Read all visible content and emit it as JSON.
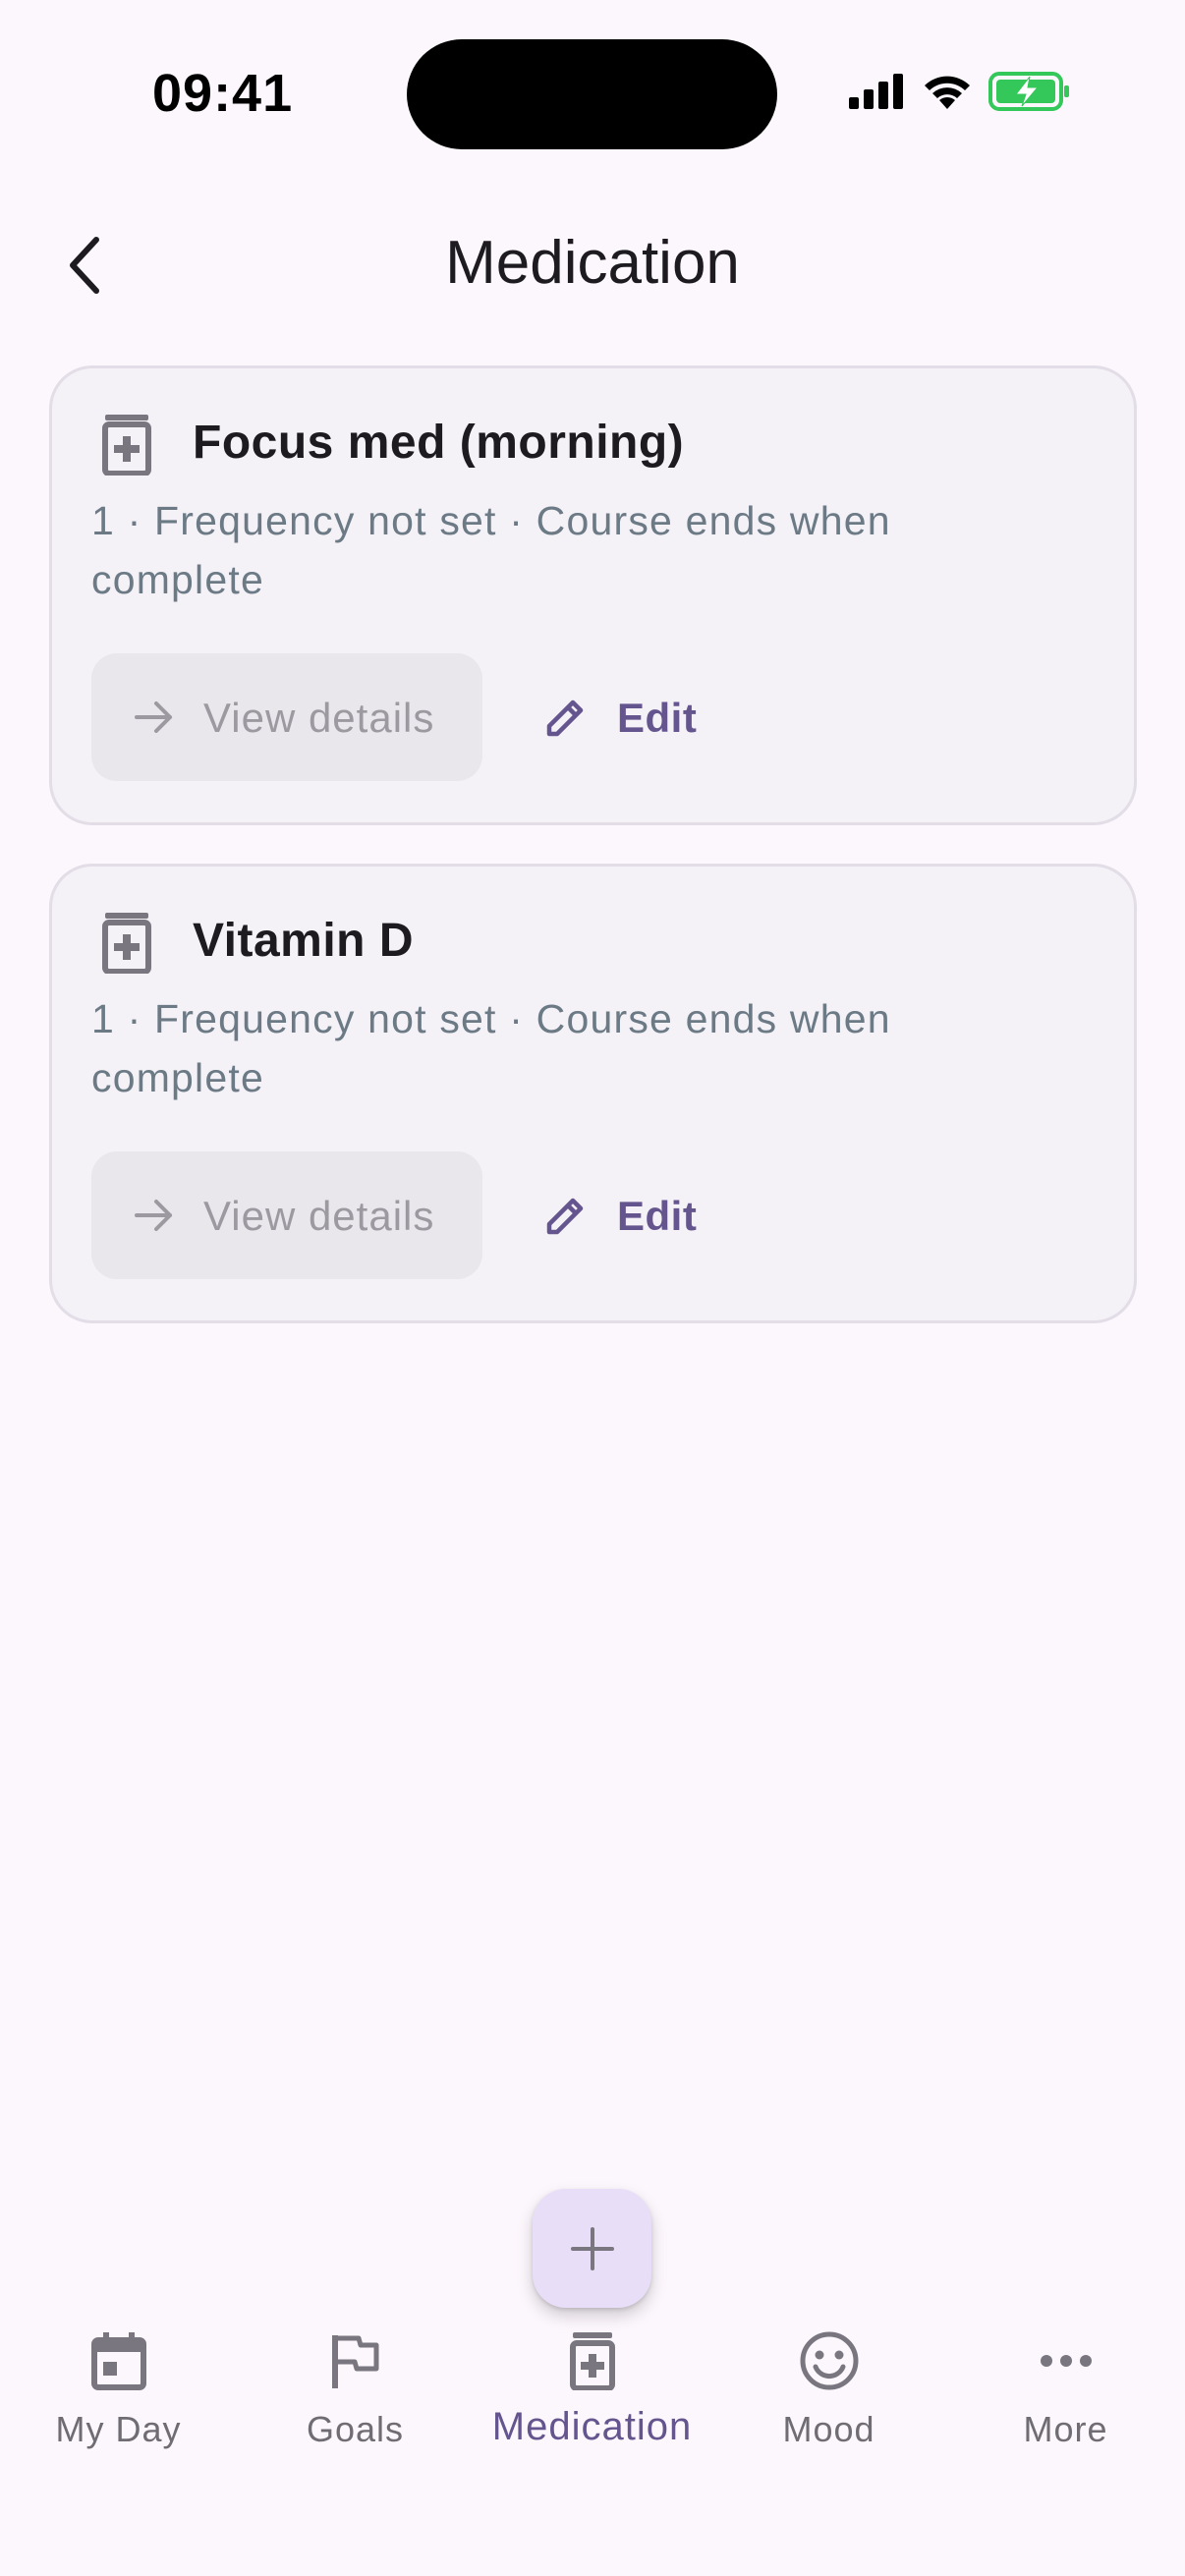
{
  "status_bar": {
    "time": "09:41"
  },
  "header": {
    "title": "Medication"
  },
  "medications": [
    {
      "name": "Focus med (morning)",
      "meta": "1 · Frequency not set · Course ends when complete",
      "view_label": "View details",
      "edit_label": "Edit"
    },
    {
      "name": "Vitamin D",
      "meta": "1 · Frequency not set · Course ends when complete",
      "view_label": "View details",
      "edit_label": "Edit"
    }
  ],
  "nav": {
    "items": [
      {
        "label": "My Day",
        "icon": "calendar-icon"
      },
      {
        "label": "Goals",
        "icon": "flag-icon"
      },
      {
        "label": "Medication",
        "icon": "medication-icon",
        "active": true
      },
      {
        "label": "Mood",
        "icon": "smiley-icon"
      },
      {
        "label": "More",
        "icon": "more-horizontal-icon"
      }
    ]
  },
  "colors": {
    "background": "#fcf7fd",
    "accent": "#65558f",
    "card": "#f4f1f7",
    "fab": "#e8def8"
  }
}
